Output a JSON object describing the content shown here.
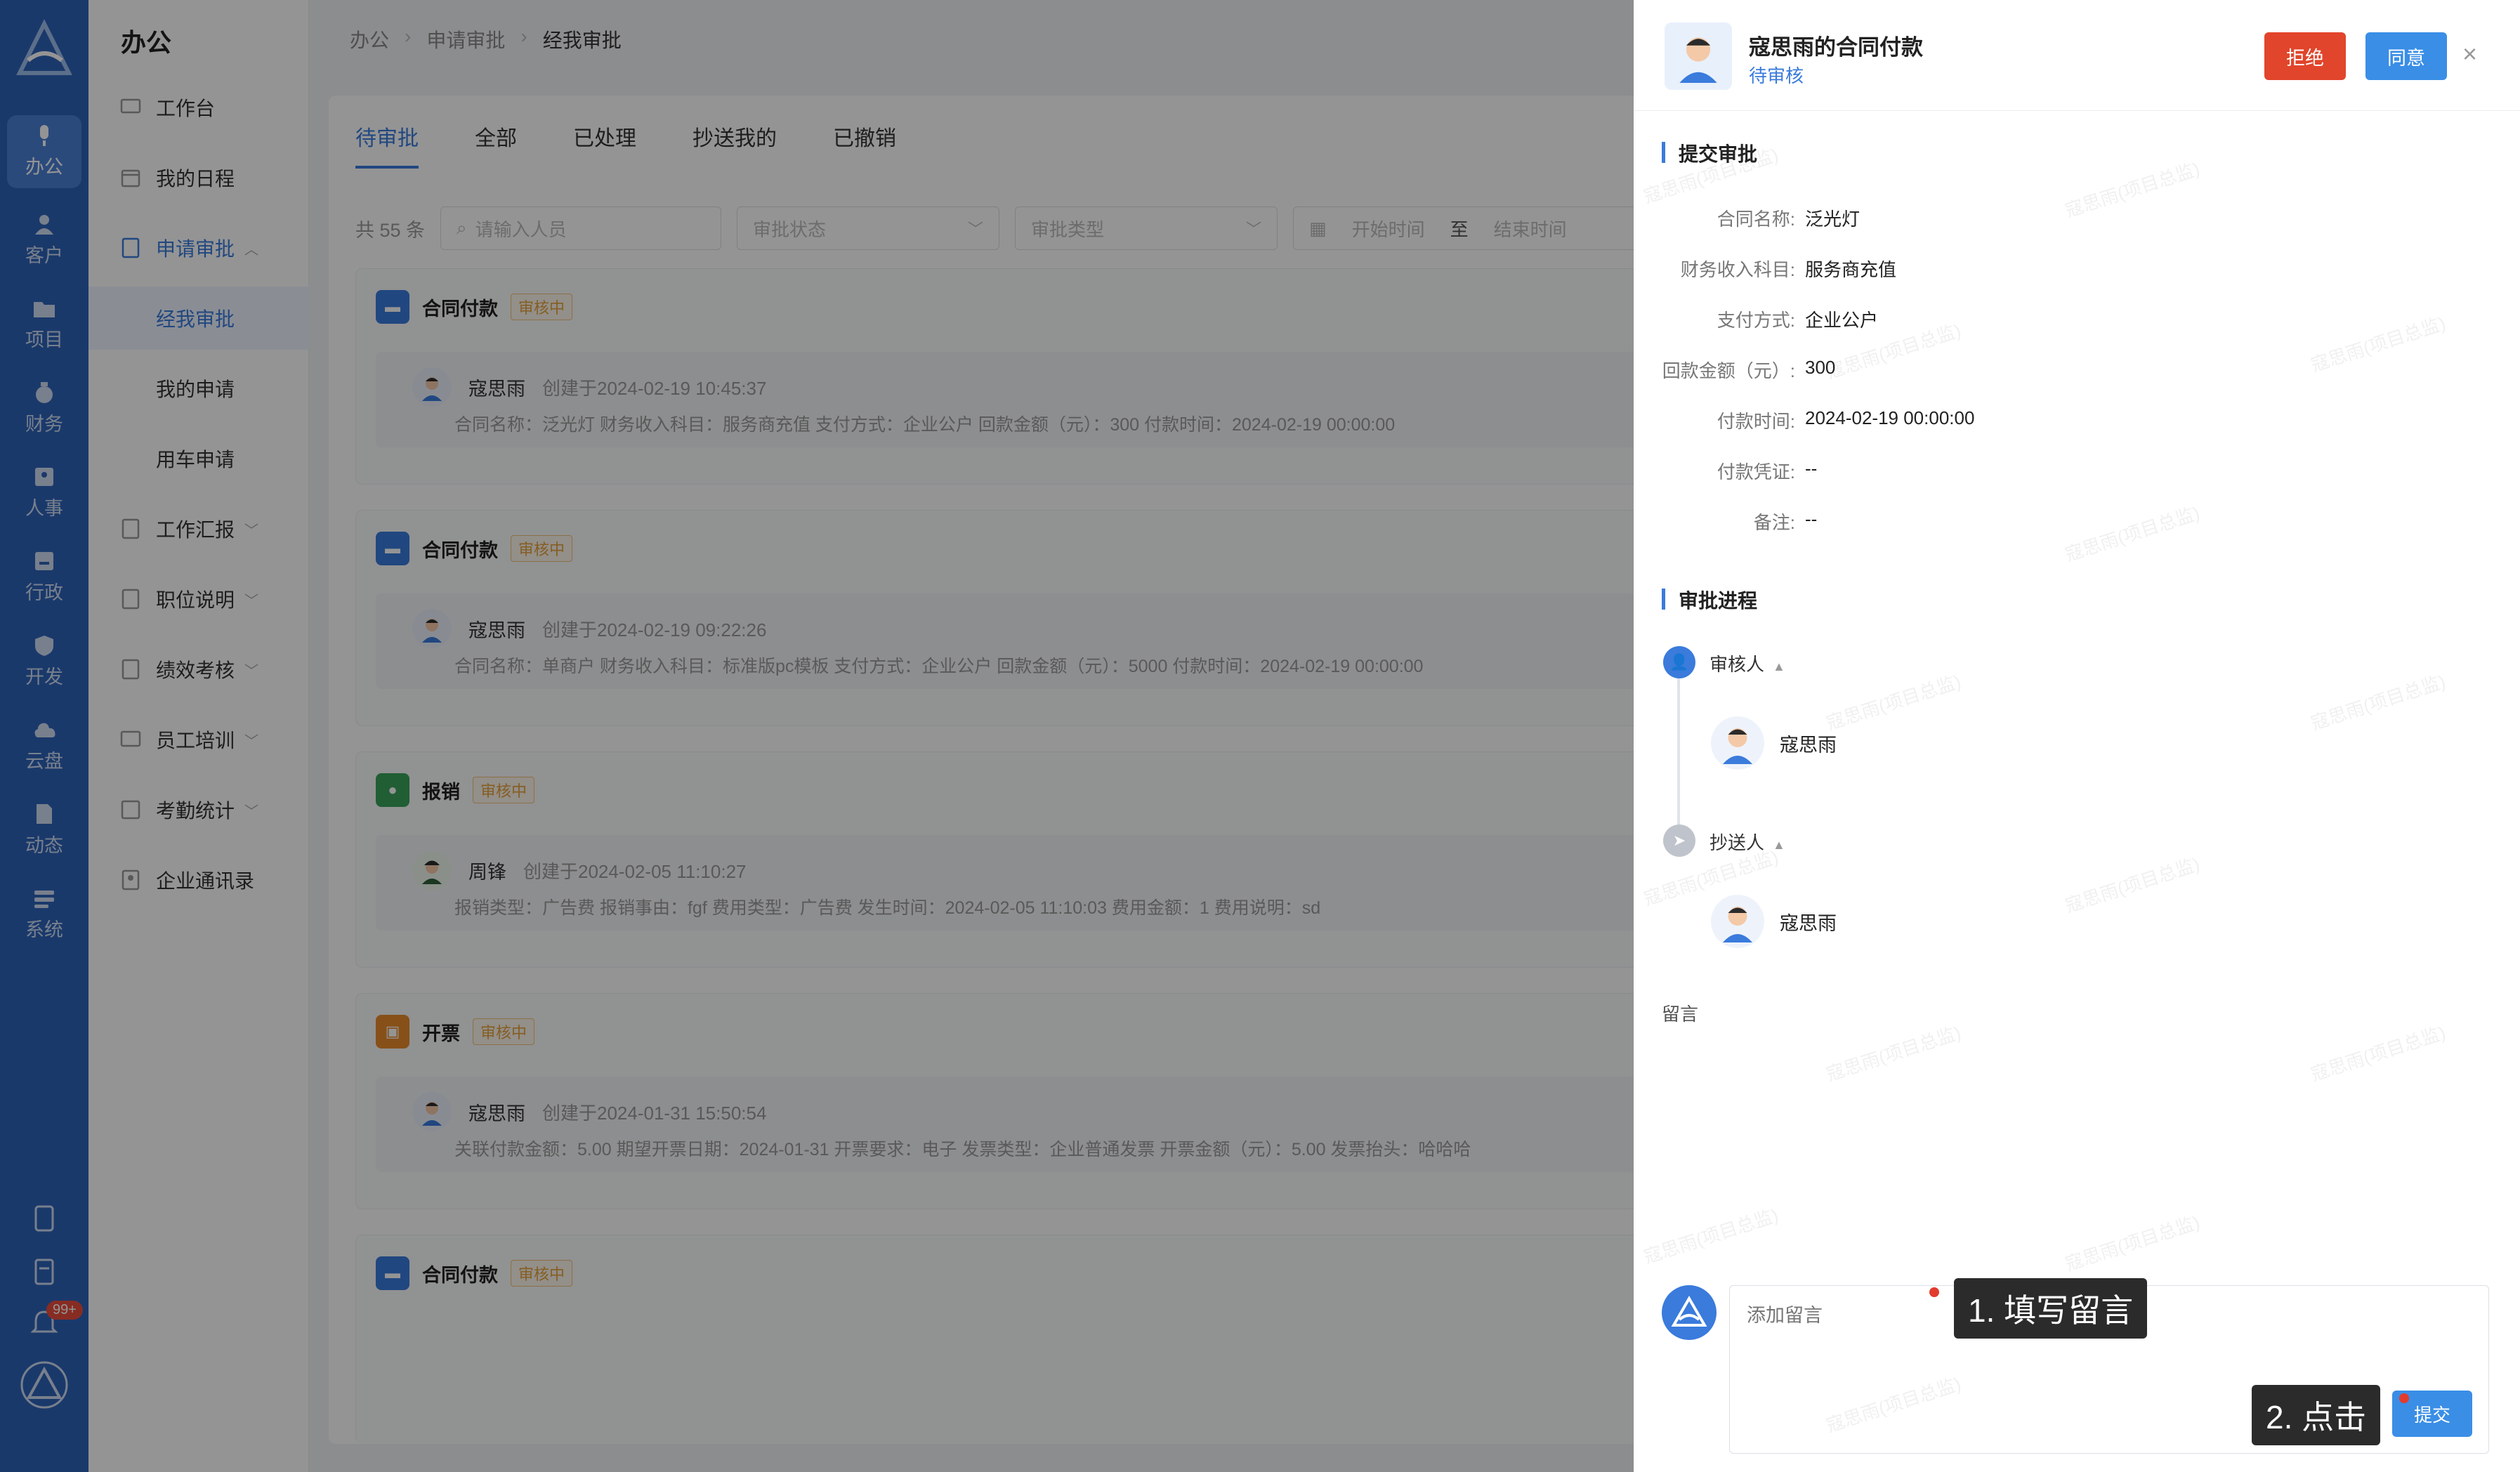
{
  "rail": {
    "items": [
      {
        "label": "办公",
        "icon": "mic-icon",
        "active": true
      },
      {
        "label": "客户",
        "icon": "user-icon"
      },
      {
        "label": "项目",
        "icon": "folder-icon"
      },
      {
        "label": "财务",
        "icon": "money-bag-icon"
      },
      {
        "label": "人事",
        "icon": "id-card-icon"
      },
      {
        "label": "行政",
        "icon": "badge-icon"
      },
      {
        "label": "开发",
        "icon": "shield-icon"
      },
      {
        "label": "云盘",
        "icon": "cloud-icon"
      },
      {
        "label": "动态",
        "icon": "file-icon"
      },
      {
        "label": "系统",
        "icon": "settings-icon"
      }
    ],
    "badge": "99+"
  },
  "menu": {
    "title": "办公",
    "items": [
      {
        "label": "工作台"
      },
      {
        "label": "我的日程"
      },
      {
        "label": "申请审批"
      },
      {
        "label": "经我审批"
      },
      {
        "label": "我的申请"
      },
      {
        "label": "用车申请"
      },
      {
        "label": "工作汇报"
      },
      {
        "label": "职位说明"
      },
      {
        "label": "绩效考核"
      },
      {
        "label": "员工培训"
      },
      {
        "label": "考勤统计"
      },
      {
        "label": "企业通讯录"
      }
    ]
  },
  "breadcrumb": [
    "办公",
    "申请审批",
    "经我审批"
  ],
  "tabs": [
    "待审批",
    "全部",
    "已处理",
    "抄送我的",
    "已撤销"
  ],
  "filters": {
    "count": "共 55 条",
    "search_placeholder": "请输入人员",
    "status_placeholder": "审批状态",
    "type_placeholder": "审批类型",
    "start_placeholder": "开始时间",
    "to": "至",
    "end_placeholder": "结束时间"
  },
  "list": [
    {
      "type": "合同付款",
      "tag": "审核中",
      "name": "寇思雨",
      "created": "创建于2024-02-19 10:45:37",
      "meta": "合同名称：泛光灯    财务收入科目：服务商充值    支付方式：企业公户    回款金额（元）：300    付款时间：2024-02-19 00:00:00"
    },
    {
      "type": "合同付款",
      "tag": "审核中",
      "name": "寇思雨",
      "created": "创建于2024-02-19 09:22:26",
      "meta": "合同名称：单商户    财务收入科目：标准版pc模板    支付方式：企业公户    回款金额（元）：5000    付款时间：2024-02-19 00:00:00"
    },
    {
      "type": "报销",
      "tag": "审核中",
      "name": "周锋",
      "created": "创建于2024-02-05 11:10:27",
      "meta": "报销类型：广告费    报销事由：fgf    费用类型：广告费    发生时间：2024-02-05 11:10:03    费用金额：1    费用说明：sd"
    },
    {
      "type": "开票",
      "tag": "审核中",
      "name": "寇思雨",
      "created": "创建于2024-01-31 15:50:54",
      "meta": "关联付款金额：5.00    期望开票日期：2024-01-31    开票要求：电子    发票类型：企业普通发票    开票金额（元）：5.00    发票抬头：哈哈哈"
    },
    {
      "type": "合同付款",
      "tag": "审核中"
    }
  ],
  "drawer": {
    "title": "寇思雨的合同付款",
    "status": "待审核",
    "reject": "拒绝",
    "agree": "同意",
    "section1": "提交审批",
    "fields": [
      {
        "k": "合同名称:",
        "v": "泛光灯"
      },
      {
        "k": "财务收入科目:",
        "v": "服务商充值"
      },
      {
        "k": "支付方式:",
        "v": "企业公户"
      },
      {
        "k": "回款金额（元）:",
        "v": "300"
      },
      {
        "k": "付款时间:",
        "v": "2024-02-19 00:00:00"
      },
      {
        "k": "付款凭证:",
        "v": "--"
      },
      {
        "k": "备注:",
        "v": "--"
      }
    ],
    "section2": "审批进程",
    "reviewer_label": "审核人",
    "reviewer_name": "寇思雨",
    "cc_label": "抄送人",
    "cc_name": "寇思雨",
    "message_label": "留言",
    "message_placeholder": "添加留言",
    "submit": "提交",
    "hint1": "1. 填写留言",
    "hint2": "2. 点击"
  },
  "watermark": "寇思雨(项目总监)",
  "colors": {
    "primary": "#3a7bdc",
    "rail": "#2e63b8",
    "reject": "#e1452b",
    "tag": "#e6a23c"
  }
}
